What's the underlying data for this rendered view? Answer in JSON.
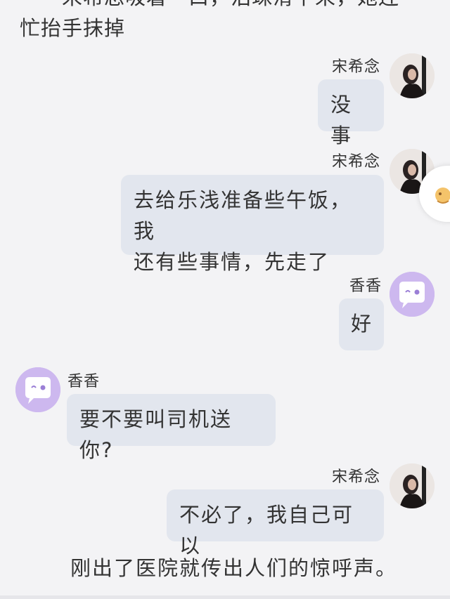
{
  "story": {
    "top_line_partial": "宋希念吸着一口，泪珠滑下来，她连",
    "top_line_2": "忙抬手抹掉",
    "narration": "刚出了医院就传出人们的惊呼声。"
  },
  "messages": [
    {
      "sender": "宋希念",
      "side": "right",
      "avatar": "photo-avatar",
      "text": "没事"
    },
    {
      "sender": "宋希念",
      "side": "right",
      "avatar": "photo-avatar",
      "lines": [
        "去给乐浅准备些午饭，我",
        "还有些事情，先走了"
      ]
    },
    {
      "sender": "香香",
      "side": "right",
      "avatar": "chat-bubble-mascot-icon",
      "text": "好"
    },
    {
      "sender": "香香",
      "side": "left",
      "avatar": "chat-bubble-mascot-icon",
      "text": "要不要叫司机送你?"
    },
    {
      "sender": "宋希念",
      "side": "right",
      "avatar": "photo-avatar",
      "text": "不必了，我自己可以"
    }
  ],
  "colors": {
    "background": "#f3f3f5",
    "bubble": "#e2e6ee",
    "mascot_avatar": "#cdb8ef"
  }
}
